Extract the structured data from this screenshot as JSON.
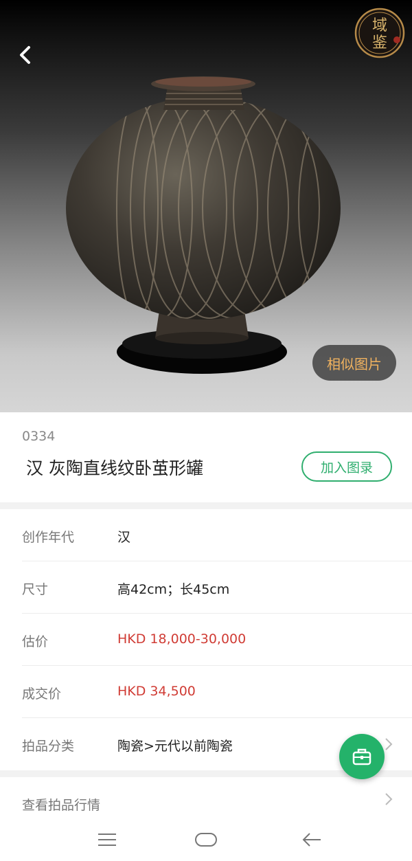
{
  "hero": {
    "logo_text": [
      "域",
      "鉴"
    ],
    "similar_label": "相似图片"
  },
  "lot": {
    "number": "0334",
    "title": "汉 灰陶直线纹卧茧形罐",
    "add_label": "加入图录"
  },
  "details": {
    "rows": [
      {
        "label": "创作年代",
        "value": "汉"
      },
      {
        "label": "尺寸",
        "value": "高42cm；长45cm"
      },
      {
        "label": "估价",
        "value": "HKD  18,000-30,000"
      },
      {
        "label": "成交价",
        "value": "HKD 34,500"
      },
      {
        "label": "拍品分类",
        "value": "陶瓷>元代以前陶瓷"
      }
    ]
  },
  "market": {
    "label": "查看拍品行情"
  },
  "colors": {
    "accent_green": "#24b26a",
    "price_red": "#d03c35",
    "similar_text": "#f0b25f"
  },
  "icons": {
    "back": "chevron-left-icon",
    "fab": "briefcase-icon",
    "nav": [
      "menu-icon",
      "home-icon",
      "back-arrow-icon"
    ]
  }
}
